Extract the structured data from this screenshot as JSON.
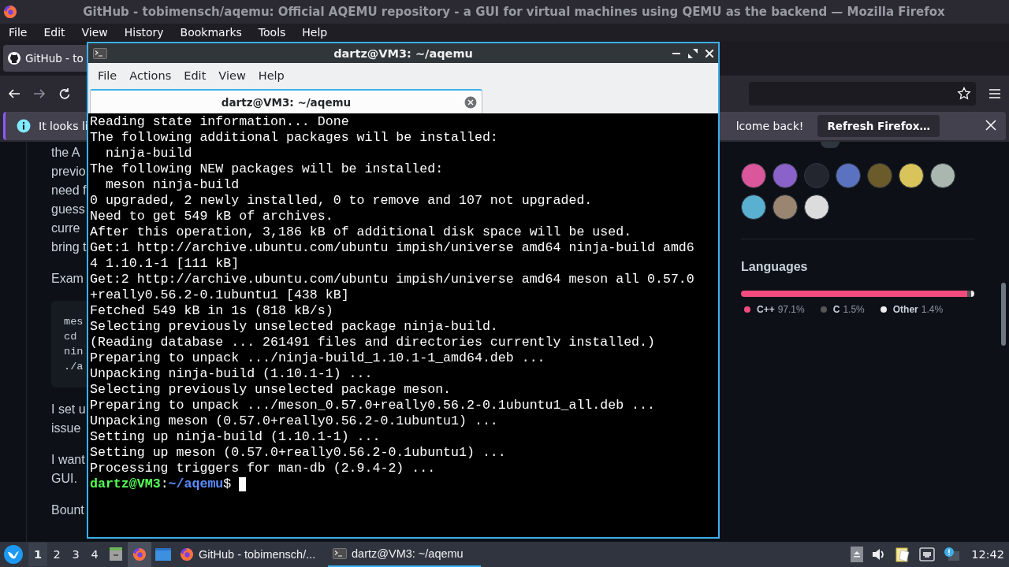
{
  "firefox": {
    "title": "GitHub - tobimensch/aqemu: Official AQEMU repository - a GUI for virtual machines using QEMU as the backend — Mozilla Firefox",
    "menu": [
      "File",
      "Edit",
      "View",
      "History",
      "Bookmarks",
      "Tools",
      "Help"
    ],
    "tabs": [
      {
        "label": "GitHub - to",
        "selected": true
      }
    ],
    "notification": {
      "text_start": "It looks li",
      "text_end": "lcome back!",
      "button": "Refresh Firefox…"
    }
  },
  "page": {
    "blocks": [
      {
        "kind": "text",
        "lines": [
          "the A",
          "previo",
          "need f",
          "guess",
          "curre",
          "bring t"
        ]
      },
      {
        "kind": "text",
        "lines": [
          "Exam"
        ]
      },
      {
        "kind": "code",
        "lines": [
          "mes",
          "cd",
          "nin",
          "./a"
        ]
      },
      {
        "kind": "text",
        "lines": [
          "I set u",
          "issue"
        ]
      },
      {
        "kind": "text",
        "lines": [
          "I want",
          "GUI."
        ]
      },
      {
        "kind": "text",
        "lines": [
          "Bount"
        ]
      }
    ],
    "contributors": [
      {
        "color": "#d9579a"
      },
      {
        "color": "#8a62c9"
      },
      {
        "color": "#23262e"
      },
      {
        "color": "#5a72c0"
      },
      {
        "color": "#6b5a2a"
      },
      {
        "color": "#d8c45a"
      },
      {
        "color": "#a9b7b0"
      },
      {
        "color": "#5ab0d0"
      },
      {
        "color": "#9a8570"
      },
      {
        "color": "#dcdcdc"
      }
    ],
    "languages": {
      "title": "Languages",
      "items": [
        {
          "name": "C++",
          "percent": "97.1%",
          "level": 0.971,
          "color": "#f34b7d"
        },
        {
          "name": "C",
          "percent": "1.5%",
          "level": 0.015,
          "color": "#555555"
        },
        {
          "name": "Other",
          "percent": "1.4%",
          "color": "#ededed"
        }
      ]
    }
  },
  "terminal": {
    "title": "dartz@VM3: ~/aqemu",
    "menu": [
      "File",
      "Actions",
      "Edit",
      "View",
      "Help"
    ],
    "tabs": [
      {
        "label": "dartz@VM3: ~/aqemu",
        "selected": true
      }
    ],
    "lines": [
      "Reading state information... Done",
      "The following additional packages will be installed:",
      "  ninja-build",
      "The following NEW packages will be installed:",
      "  meson ninja-build",
      "0 upgraded, 2 newly installed, 0 to remove and 107 not upgraded.",
      "Need to get 549 kB of archives.",
      "After this operation, 3,186 kB of additional disk space will be used.",
      "Get:1 http://archive.ubuntu.com/ubuntu impish/universe amd64 ninja-build amd6",
      "4 1.10.1-1 [111 kB]",
      "Get:2 http://archive.ubuntu.com/ubuntu impish/universe amd64 meson all 0.57.0",
      "+really0.56.2-0.1ubuntu1 [438 kB]",
      "Fetched 549 kB in 1s (818 kB/s)",
      "Selecting previously unselected package ninja-build.",
      "(Reading database ... 261491 files and directories currently installed.)",
      "Preparing to unpack .../ninja-build_1.10.1-1_amd64.deb ...",
      "Unpacking ninja-build (1.10.1-1) ...",
      "Selecting previously unselected package meson.",
      "Preparing to unpack .../meson_0.57.0+really0.56.2-0.1ubuntu1_all.deb ...",
      "Unpacking meson (0.57.0+really0.56.2-0.1ubuntu1) ...",
      "Setting up ninja-build (1.10.1-1) ...",
      "Setting up meson (0.57.0+really0.56.2-0.1ubuntu1) ...",
      "Processing triggers for man-db (2.9.4-2) ..."
    ],
    "prompt": {
      "user": "dartz@VM3",
      "separator": ":",
      "path": "~/aqemu",
      "symbol": "$"
    }
  },
  "taskbar": {
    "workspaces": [
      {
        "label": "1",
        "selected": true
      },
      {
        "label": "2",
        "selected": false
      },
      {
        "label": "3",
        "selected": false
      },
      {
        "label": "4",
        "selected": false
      }
    ],
    "tasks": [
      {
        "label": "GitHub - tobimensch/...",
        "kind": "browser",
        "selected": false
      },
      {
        "label": "dartz@VM3: ~/aqemu",
        "kind": "terminal",
        "selected": true
      }
    ],
    "clock": "12:42"
  }
}
